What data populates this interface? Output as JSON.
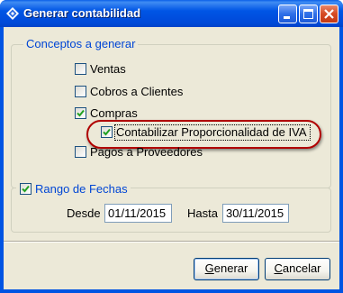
{
  "window": {
    "title": "Generar contabilidad",
    "icon": "app-logo-icon"
  },
  "title_buttons": [
    "minimize",
    "maximize",
    "close"
  ],
  "conceptos": {
    "legend": "Conceptos a generar",
    "items": [
      {
        "label": "Ventas",
        "checked": false
      },
      {
        "label": "Cobros a Clientes",
        "checked": false
      },
      {
        "label": "Compras",
        "checked": true
      },
      {
        "label": "Contabilizar Proporcionalidad de IVA",
        "checked": true,
        "indented": true,
        "focused": true
      },
      {
        "label": "Pagos a Proveedores",
        "checked": false
      }
    ]
  },
  "rango": {
    "legend": "Rango de Fechas",
    "checked": true,
    "desde_label": "Desde",
    "desde_value": "01/11/2015",
    "hasta_label": "Hasta",
    "hasta_value": "30/11/2015"
  },
  "buttons": {
    "generar_first": "G",
    "generar_rest": "enerar",
    "cancelar_first": "C",
    "cancelar_rest": "ancelar"
  },
  "colors": {
    "titlebar": "#0054e3",
    "dialog_bg": "#ece9d8",
    "legend_text": "#0046d5",
    "highlight_ring": "#b00000"
  }
}
